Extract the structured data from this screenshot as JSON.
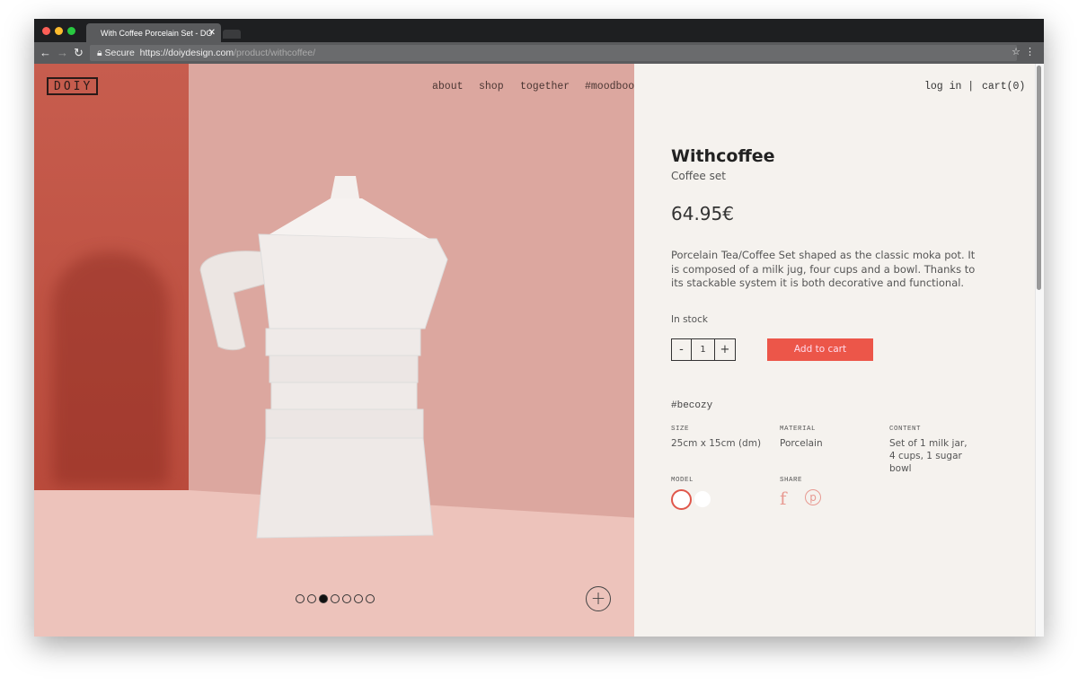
{
  "browser": {
    "tab_title": "With Coffee Porcelain Set - DO",
    "secure_label": "Secure",
    "url_host": "https://doiydesign.com",
    "url_path": "/product/withcoffee/"
  },
  "site": {
    "logo": "DOIY",
    "nav": [
      "about",
      "shop",
      "together",
      "#moodbook"
    ],
    "login": "log in |",
    "cart": "cart(0)"
  },
  "carousel": {
    "slides": 7,
    "active_index": 2
  },
  "product": {
    "name": "Withcoffee",
    "subtitle": "Coffee set",
    "price": "64.95€",
    "description": "Porcelain Tea/Coffee Set shaped as the classic moka pot. It is composed of a milk jug, four cups and a bowl. Thanks to its stackable system it is both decorative and functional.",
    "stock": "In stock",
    "qty_minus": "-",
    "quantity": "1",
    "qty_plus": "+",
    "add_to_cart": "Add to cart",
    "hashtag": "#becozy",
    "specs": [
      {
        "label": "SIZE",
        "value": "25cm x 15cm (dm)"
      },
      {
        "label": "MATERIAL",
        "value": "Porcelain"
      },
      {
        "label": "CONTENT",
        "value": "Set of 1 milk jar, 4 cups, 1 sugar bowl"
      }
    ],
    "model_label": "MODEL",
    "share_label": "SHARE",
    "share_icons": [
      "facebook-icon",
      "pinterest-icon"
    ]
  },
  "colors": {
    "accent": "#ec5649",
    "panel": "#f5f2ee",
    "hero": "#dca79f"
  }
}
